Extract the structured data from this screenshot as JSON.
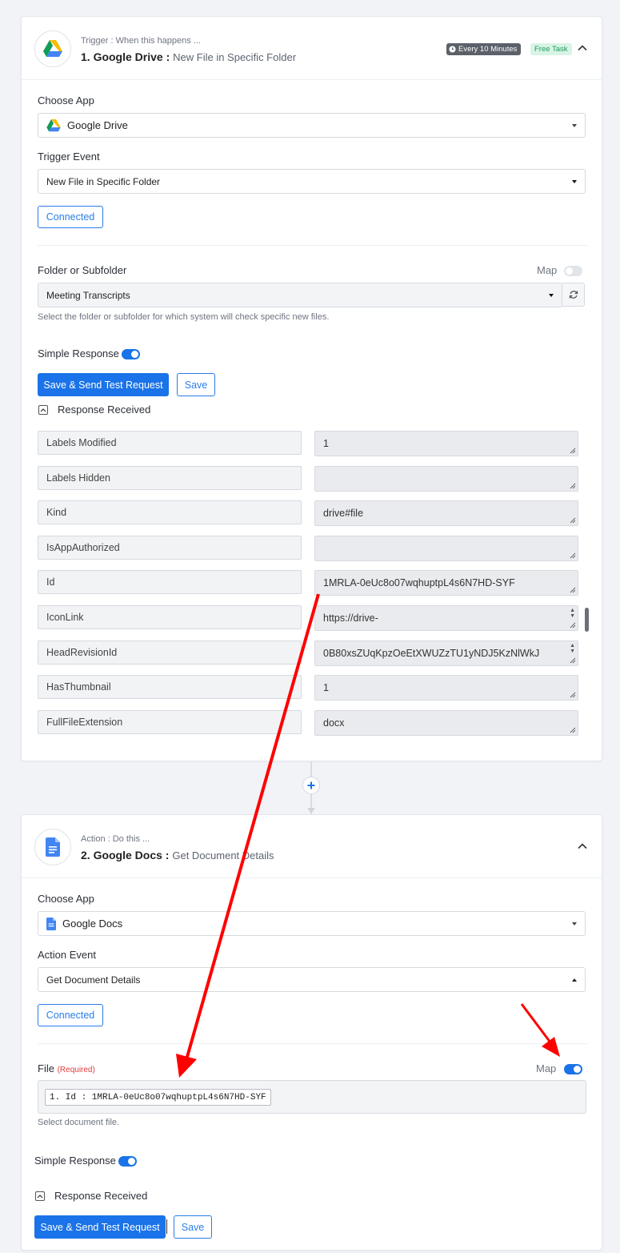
{
  "colors": {
    "primary": "#1a73e8",
    "red_arrow": "#ff0000",
    "required": "#e23b3b",
    "free_badge_bg": "#d8f4e5",
    "free_badge_text": "#1d9d5c"
  },
  "trigger": {
    "subtitle": "Trigger : When this happens ...",
    "step": "1. Google Drive :",
    "event_name": "New File in Specific Folder",
    "schedule_badge": "Every 10 Minutes",
    "task_badge": "Free Task",
    "app_icon": "google-drive-icon",
    "choose_app_label": "Choose App",
    "app_value": "Google Drive",
    "event_label": "Trigger Event",
    "event_value": "New File in Specific Folder",
    "connected_label": "Connected",
    "folder_label": "Folder or Subfolder",
    "map_label": "Map",
    "map_on": false,
    "folder_value": "Meeting Transcripts",
    "folder_hint": "Select the folder or subfolder for which system will check specific new files.",
    "simple_response_label": "Simple Response",
    "simple_response_on": true,
    "send_test_label": "Save & Send Test Request",
    "save_label": "Save",
    "response_received_label": "Response Received",
    "response_rows": [
      {
        "key": "Labels Modified",
        "value": "1"
      },
      {
        "key": "Labels Hidden",
        "value": ""
      },
      {
        "key": "Kind",
        "value": "drive#file"
      },
      {
        "key": "IsAppAuthorized",
        "value": ""
      },
      {
        "key": "Id",
        "value": "1MRLA-0eUc8o07wqhuptpL4s6N7HD-SYF"
      },
      {
        "key": "IconLink",
        "value": "https://drive-"
      },
      {
        "key": "HeadRevisionId",
        "value": "0B80xsZUqKpzOeEtXWUZzTU1yNDJ5KzNlWkJ"
      },
      {
        "key": "HasThumbnail",
        "value": "1"
      },
      {
        "key": "FullFileExtension",
        "value": "docx"
      }
    ]
  },
  "action": {
    "subtitle": "Action : Do this ...",
    "step": "2. Google Docs :",
    "event_name": "Get Document Details",
    "app_icon": "google-docs-icon",
    "choose_app_label": "Choose App",
    "app_value": "Google Docs",
    "event_label": "Action Event",
    "event_value": "Get Document Details",
    "connected_label": "Connected",
    "file_label": "File",
    "file_required": "(Required)",
    "map_label": "Map",
    "map_on": true,
    "file_token": "1. Id : 1MRLA-0eUc8o07wqhuptpL4s6N7HD-SYF",
    "file_hint": "Select document file.",
    "simple_response_label": "Simple Response",
    "simple_response_on": true,
    "response_received_label": "Response Received",
    "send_test_label": "Save & Send Test Request",
    "save_label": "Save"
  }
}
